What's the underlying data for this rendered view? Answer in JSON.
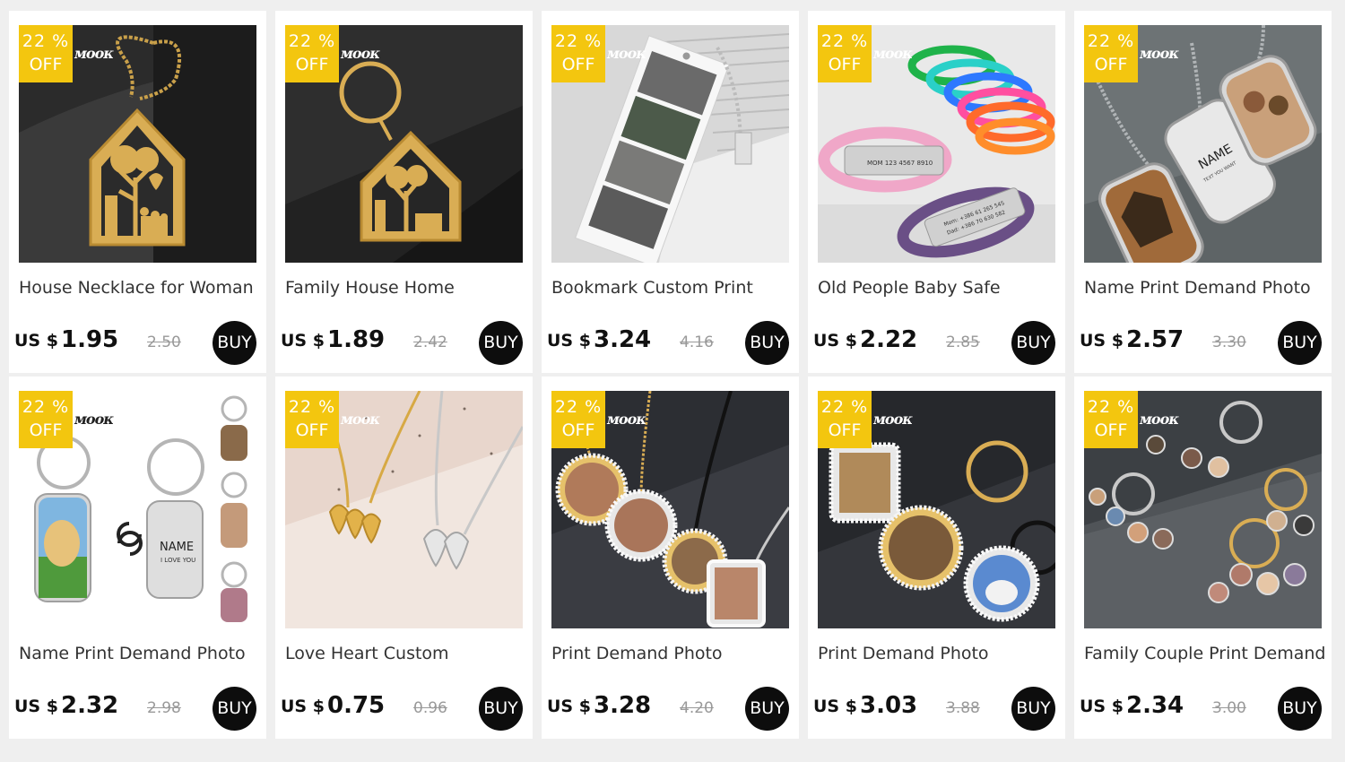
{
  "brand_colors": {
    "badge": "#f3c60f",
    "buy": "#0d0d0d",
    "background": "#efefef"
  },
  "products": [
    {
      "title": "House Necklace for Woman",
      "currency": "US $",
      "price": "1.95",
      "old_price": "2.50",
      "discount_pct": "22 %",
      "discount_off": "OFF",
      "buy_label": "BUY",
      "logo": "ᴍᴏᴏᴋ",
      "image": "gold-house-necklace"
    },
    {
      "title": "Family House Home",
      "currency": "US $",
      "price": "1.89",
      "old_price": "2.42",
      "discount_pct": "22 %",
      "discount_off": "OFF",
      "buy_label": "BUY",
      "logo": "ᴍᴏᴏᴋ",
      "image": "gold-house-keychain"
    },
    {
      "title": "Bookmark Custom Print",
      "currency": "US $",
      "price": "3.24",
      "old_price": "4.16",
      "discount_pct": "22 %",
      "discount_off": "OFF",
      "buy_label": "BUY",
      "logo": "ᴍᴏᴏᴋ",
      "image": "photo-bookmark"
    },
    {
      "title": "Old People Baby Safe",
      "currency": "US $",
      "price": "2.22",
      "old_price": "2.85",
      "discount_pct": "22 %",
      "discount_off": "OFF",
      "buy_label": "BUY",
      "logo": "ᴍᴏᴏᴋ",
      "image": "silicone-id-bracelets"
    },
    {
      "title": "Name Print Demand Photo",
      "currency": "US $",
      "price": "2.57",
      "old_price": "3.30",
      "discount_pct": "22 %",
      "discount_off": "OFF",
      "buy_label": "BUY",
      "logo": "ᴍᴏᴏᴋ",
      "image": "photo-dog-tags"
    },
    {
      "title": "Name Print Demand Photo",
      "currency": "US $",
      "price": "2.32",
      "old_price": "2.98",
      "discount_pct": "22 %",
      "discount_off": "OFF",
      "buy_label": "BUY",
      "logo": "ᴍᴏᴏᴋ",
      "image": "photo-tag-keychains"
    },
    {
      "title": "Love Heart Custom",
      "currency": "US $",
      "price": "0.75",
      "old_price": "0.96",
      "discount_pct": "22 %",
      "discount_off": "OFF",
      "buy_label": "BUY",
      "logo": "ᴍᴏᴏᴋ",
      "image": "heart-necklaces"
    },
    {
      "title": "Print Demand Photo",
      "currency": "US $",
      "price": "3.28",
      "old_price": "4.20",
      "discount_pct": "22 %",
      "discount_off": "OFF",
      "buy_label": "BUY",
      "logo": "ᴍᴏᴏᴋ",
      "image": "rhinestone-photo-pendants"
    },
    {
      "title": "Print Demand Photo",
      "currency": "US $",
      "price": "3.03",
      "old_price": "3.88",
      "discount_pct": "22 %",
      "discount_off": "OFF",
      "buy_label": "BUY",
      "logo": "ᴍᴏᴏᴋ",
      "image": "rhinestone-photo-keychains"
    },
    {
      "title": "Family Couple Print Demand",
      "currency": "US $",
      "price": "2.34",
      "old_price": "3.00",
      "discount_pct": "22 %",
      "discount_off": "OFF",
      "buy_label": "BUY",
      "logo": "ᴍᴏᴏᴋ",
      "image": "round-photo-keychains"
    }
  ],
  "image_text": {
    "bracelet_plate_1": "MOM 123 4567 8910",
    "bracelet_plate_2a": "Mom: +386 61 265 545",
    "bracelet_plate_2b": "Dad: +386 70 630 582",
    "dogtag_name": "NAME",
    "dogtag_sub": "TEXT YOU WANT",
    "keytag_name": "NAME",
    "keytag_sub": "I LOVE YOU"
  }
}
